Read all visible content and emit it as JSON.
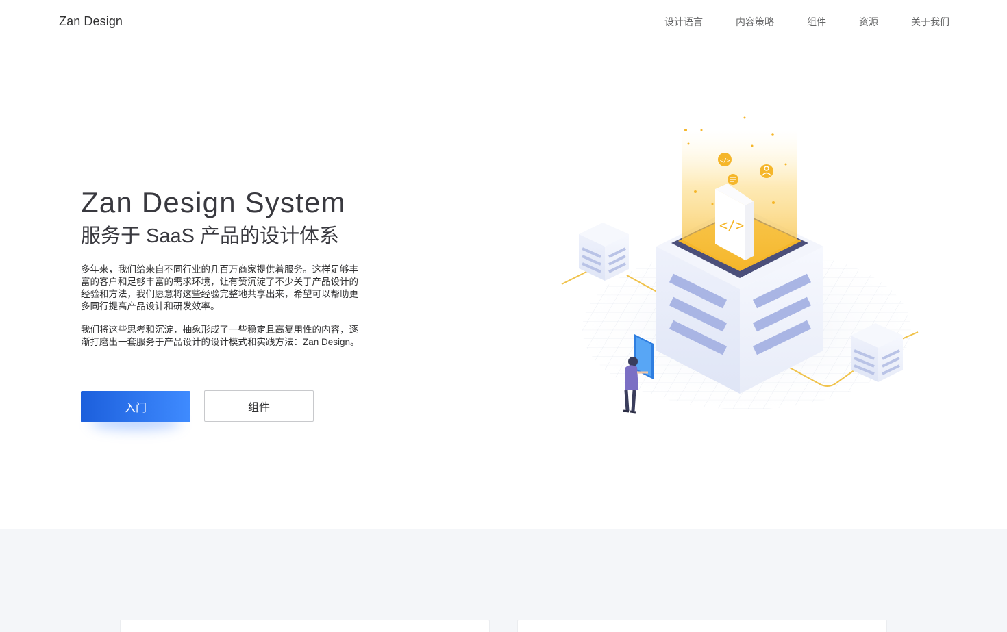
{
  "nav": {
    "logo": "Zan Design",
    "items": [
      {
        "label": "设计语言"
      },
      {
        "label": "内容策略"
      },
      {
        "label": "组件"
      },
      {
        "label": "资源"
      },
      {
        "label": "关于我们"
      }
    ]
  },
  "hero": {
    "title": "Zan Design System",
    "subtitle": "服务于 SaaS 产品的设计体系",
    "paragraph_1": "多年来，我们给来自不同行业的几百万商家提供着服务。这样足够丰富的客户和足够丰富的需求环境，让有赞沉淀了不少关于产品设计的经验和方法，我们愿意将这些经验完整地共享出来，希望可以帮助更多同行提高产品设计和研发效率。",
    "paragraph_2": "我们将这些思考和沉淀，抽象形成了一些稳定且高复用性的内容，逐渐打磨出一套服务于产品设计的设计模式和实践方法：Zan Design。",
    "primary_button": "入门",
    "secondary_button": "组件"
  },
  "colors": {
    "primary": "#1c5fdc",
    "primary_end": "#3f8bff",
    "accent_gold": "#f5b62a",
    "band": "#f4f6f9"
  }
}
